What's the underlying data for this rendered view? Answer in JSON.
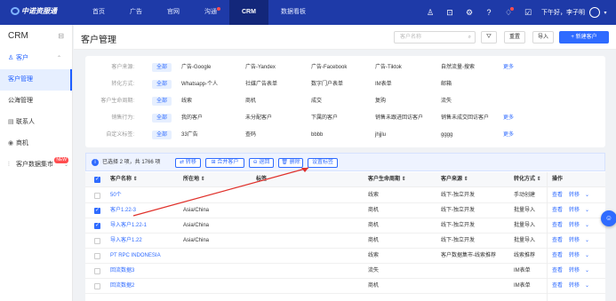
{
  "topbar": {
    "logo_text": "中诺资服通",
    "nav": [
      "首页",
      "广告",
      "官网",
      "沟通",
      "CRM",
      "数据看板"
    ],
    "greeting": "下午好，李子明",
    "icons": [
      "user-icon",
      "export-icon",
      "settings-icon",
      "help-icon",
      "bell-icon",
      "task-icon"
    ]
  },
  "sidebar": {
    "title": "CRM",
    "items": [
      {
        "label": "客户",
        "icon": "user-icon"
      },
      {
        "label": "客户管理"
      },
      {
        "label": "公海管理"
      },
      {
        "label": "联系人",
        "icon": "contact-icon"
      },
      {
        "label": "商机",
        "icon": "location-icon"
      },
      {
        "label": "客户数据集市",
        "icon": "data-icon",
        "badge": "NEW"
      }
    ]
  },
  "header": {
    "title": "客户管理",
    "search_placeholder": "客户名称",
    "reset_label": "重置",
    "import_label": "导入",
    "new_label": "+ 新建客户"
  },
  "filters": [
    {
      "label": "客户来源:",
      "all": "全部",
      "options": [
        "广告-Google",
        "广告-Yandex",
        "广告-Facebook",
        "广告-Tiktok",
        "自然流量-搜索"
      ],
      "more": "更多"
    },
    {
      "label": "转化方式:",
      "all": "全部",
      "options": [
        "Whatsapp-个人",
        "社媒广告表单",
        "数字门户表单",
        "IM表单",
        "邮箱"
      ],
      "more": ""
    },
    {
      "label": "客户生命周期:",
      "all": "全部",
      "options": [
        "线索",
        "商机",
        "成交",
        "复购",
        "流失"
      ],
      "more": ""
    },
    {
      "label": "销售行为:",
      "all": "全部",
      "options": [
        "我的客户",
        "未分配客户",
        "下属的客户",
        "销售未跟进回访客户",
        "销售未成交回访客户"
      ],
      "more": "更多"
    },
    {
      "label": "自定义标签:",
      "all": "全部",
      "options": [
        "33广告",
        "查码",
        "bbbb",
        "jhjjlu",
        "gggg"
      ],
      "more": "更多"
    }
  ],
  "selection": {
    "info": "已选择 2 项，共 1766 项",
    "buttons": [
      "转移",
      "合并客户",
      "退回",
      "删除",
      "设置标签"
    ]
  },
  "table": {
    "headers": [
      "客户名称 ⇕",
      "所在地 ⇕",
      "标签",
      "客户生命周期 ⇕",
      "客户来源 ⇕",
      "转化方式 ⇕",
      "操作"
    ],
    "rows": [
      {
        "name": "50个",
        "location": "",
        "lifecycle": "线索",
        "source": "线下-独立开发",
        "conversion": "手动创建",
        "checked": false
      },
      {
        "name": "客户1.22-3",
        "location": "Asia/China",
        "lifecycle": "商机",
        "source": "线下-独立开发",
        "conversion": "批量导入",
        "checked": true
      },
      {
        "name": "导入客户1.22-1",
        "location": "Asia/China",
        "lifecycle": "商机",
        "source": "线下-独立开发",
        "conversion": "批量导入",
        "checked": true
      },
      {
        "name": "导入客户1.22",
        "location": "Asia/China",
        "lifecycle": "商机",
        "source": "线下-独立开发",
        "conversion": "批量导入",
        "checked": false
      },
      {
        "name": "PT RPC INDONESIA",
        "location": "",
        "lifecycle": "线索",
        "source": "客户数据集市-线索推荐",
        "conversion": "线索推荐",
        "checked": false
      },
      {
        "name": "回流数据3",
        "location": "",
        "lifecycle": "流失",
        "source": "",
        "conversion": "IM表单",
        "checked": false
      },
      {
        "name": "回流数据2",
        "location": "",
        "lifecycle": "商机",
        "source": "",
        "conversion": "IM表单",
        "checked": false
      }
    ],
    "action_view": "查看",
    "action_transfer": "转移",
    "action_more": "⌄"
  },
  "colors": {
    "primary": "#2f6bff",
    "topbar": "#1e3aa8",
    "annotation": "#e0312b"
  }
}
